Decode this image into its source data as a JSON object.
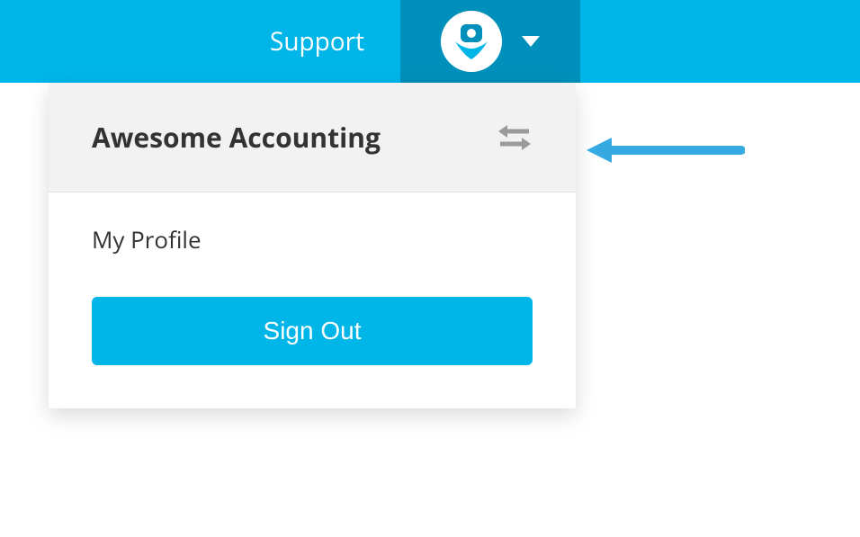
{
  "topbar": {
    "support_label": "Support"
  },
  "dropdown": {
    "account_name": "Awesome Accounting",
    "my_profile_label": "My Profile",
    "sign_out_label": "Sign Out"
  },
  "colors": {
    "primary": "#00b5e8",
    "primary_dark": "#0090bb",
    "arrow": "#36a9e1"
  }
}
